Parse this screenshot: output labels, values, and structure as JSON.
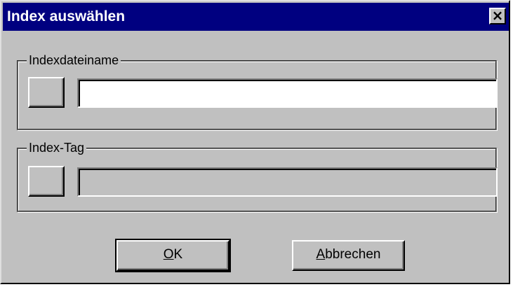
{
  "window": {
    "title": "Index auswählen",
    "close_glyph": "✕"
  },
  "group_index_file": {
    "label": "Indexdateiname",
    "value": ""
  },
  "group_index_tag": {
    "label": "Index-Tag",
    "value": ""
  },
  "buttons": {
    "ok_mnemonic": "O",
    "ok_rest": "K",
    "cancel_mnemonic": "A",
    "cancel_rest": "bbrechen"
  },
  "colors": {
    "titlebar": "#000080",
    "face": "#c0c0c0"
  },
  "icons": {
    "close": "close-icon"
  }
}
